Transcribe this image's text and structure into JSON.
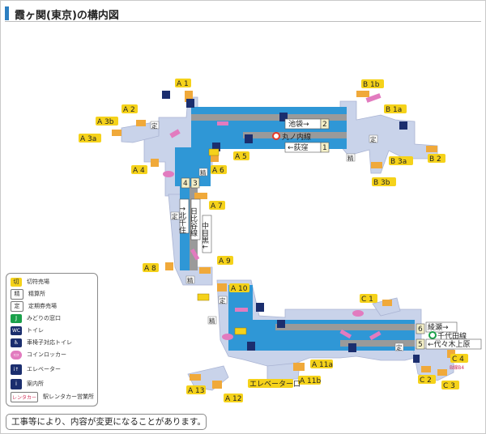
{
  "title": "霞ヶ関(東京)の構内図",
  "exits": {
    "A1": "A 1",
    "A2": "A 2",
    "A3b": "A 3b",
    "A3a": "A 3a",
    "A4": "A 4",
    "A5": "A 5",
    "A6": "A 6",
    "A7": "A 7",
    "A8": "A 8",
    "A9": "A 9",
    "A10": "A 10",
    "A11a": "A 11a",
    "A11b": "A 11b",
    "A12": "A 12",
    "A13": "A 13",
    "B1a": "B 1a",
    "B1b": "B 1b",
    "B2": "B 2",
    "B3a": "B 3a",
    "B3b": "B 3b",
    "C1": "C 1",
    "C2": "C 2",
    "C3": "C 3",
    "C4": "C 4",
    "elevator_exit": "エレベーター口"
  },
  "platforms": {
    "marunouchi": {
      "line": "丸ノ内線",
      "track2": "池袋→",
      "track2_no": "2",
      "track1": "←荻窪",
      "track1_no": "1"
    },
    "hibiya": {
      "line": "日比谷線",
      "track3_no": "3",
      "track4_no": "4",
      "to_kitasenju": "↑北千住",
      "to_nakameguro": "中目黒↓"
    },
    "chiyoda": {
      "line": "千代田線",
      "track6": "綾瀬→",
      "track6_no": "6",
      "track5": "←代々木上原",
      "track5_no": "5"
    }
  },
  "symbols": {
    "teiki": "定",
    "seisan": "精",
    "c4_note": "B線B4"
  },
  "legend": {
    "items": [
      {
        "icon": "切",
        "label": "切符売場"
      },
      {
        "icon": "精",
        "label": "精算所"
      },
      {
        "icon": "定",
        "label": "定期券売場"
      },
      {
        "icon": "J",
        "label": "みどりの窓口"
      },
      {
        "icon": "WC",
        "label": "トイレ"
      },
      {
        "icon": "♿",
        "label": "車椅子対応トイレ"
      },
      {
        "icon": "▭",
        "label": "コインロッカー"
      },
      {
        "icon": "i↑",
        "label": "エレベーター"
      },
      {
        "icon": "i",
        "label": "案内所"
      },
      {
        "icon": "レンタカー",
        "label": "駅レンタカー営業所"
      }
    ]
  },
  "notice": "工事等により、内容が変更になることがあります。",
  "colors": {
    "concourse": "#c9d3ea",
    "platform": "#2f97d6",
    "track": "#9a9a9a",
    "exit_label": "#f5d21a",
    "stairs": "#f0a93a",
    "escalator": "#e27bbf",
    "title_mark": "#2d7fc1"
  }
}
